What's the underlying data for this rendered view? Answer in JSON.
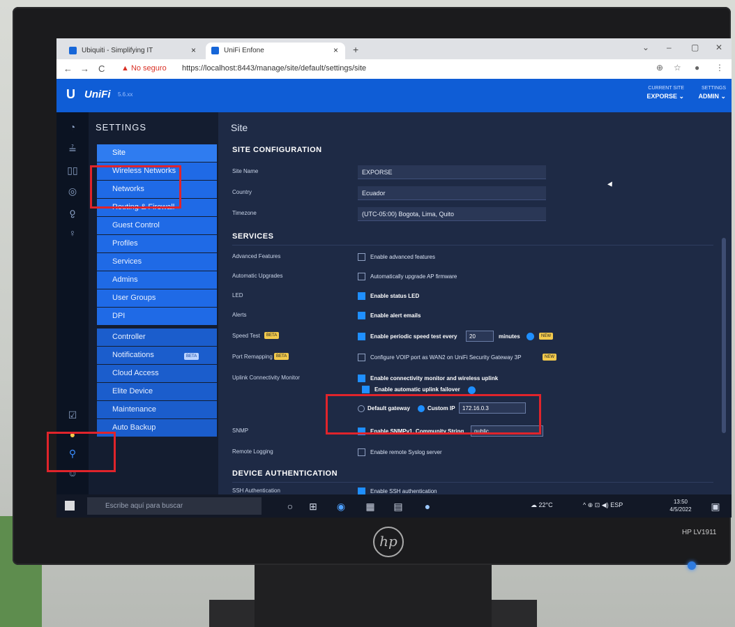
{
  "browser": {
    "tabs": [
      {
        "label": "Ubiquiti - Simplifying IT",
        "close": "×"
      },
      {
        "label": "UniFi Enfone",
        "close": "×"
      }
    ],
    "new_tab": "+",
    "window_controls": [
      "⌄",
      "–",
      "▢",
      "✕"
    ],
    "nav": {
      "back": "←",
      "forward": "→",
      "reload": "C"
    },
    "insecure_label": "▲ No seguro",
    "url": "https://localhost:8443/manage/site/default/settings/site",
    "addr_icons": [
      "⊕",
      "☆",
      "●",
      "⋮"
    ]
  },
  "unifi": {
    "logo": "U",
    "brand": "UniFi",
    "version": "5.6.xx",
    "site_label": "CURRENT SITE",
    "site_value": "EXPORSE ⌄",
    "admin_label": "SETTINGS",
    "admin_value": "ADMIN ⌄"
  },
  "rail_icons": [
    "◔",
    "≟",
    "▯▯",
    "◎",
    "ჹ",
    "♀",
    "☑",
    "●",
    "⚲",
    "☺"
  ],
  "settings": {
    "title": "SETTINGS",
    "items": [
      {
        "label": "Site"
      },
      {
        "label": "Wireless Networks"
      },
      {
        "label": "Networks"
      },
      {
        "label": "Routing & Firewall"
      },
      {
        "label": "Guest Control"
      },
      {
        "label": "Profiles"
      },
      {
        "label": "Services"
      },
      {
        "label": "Admins"
      },
      {
        "label": "User Groups"
      },
      {
        "label": "DPI"
      },
      {
        "label": "Controller"
      },
      {
        "label": "Notifications",
        "badge": "BETA"
      },
      {
        "label": "Cloud Access"
      },
      {
        "label": "Elite Device"
      },
      {
        "label": "Maintenance"
      },
      {
        "label": "Auto Backup"
      }
    ]
  },
  "content": {
    "page_title": "Site",
    "site_configuration": "SITE CONFIGURATION",
    "site_name_label": "Site Name",
    "site_name_value": "EXPORSE",
    "country_label": "Country",
    "country_value": "Ecuador",
    "timezone_label": "Timezone",
    "timezone_value": "(UTC-05:00) Bogota, Lima, Quito",
    "services": "SERVICES",
    "advanced_label": "Advanced Features",
    "advanced_check": "Enable advanced features",
    "upgrades_label": "Automatic Upgrades",
    "upgrades_check": "Automatically upgrade AP firmware",
    "led_label": "LED",
    "led_check": "Enable status LED",
    "alerts_label": "Alerts",
    "alerts_check": "Enable alert emails",
    "speedtest_label": "Speed Test",
    "speedtest_badge": "BETA",
    "speedtest_check": "Enable periodic speed test every",
    "speedtest_value": "20",
    "speedtest_unit": "minutes",
    "speedtest_new": "NEW",
    "portremap_label": "Port Remapping",
    "portremap_badge": "BETA",
    "portremap_check": "Configure VOIP port as WAN2 on UniFi Security Gateway 3P",
    "portremap_new": "NEW",
    "uplink_label": "Uplink Connectivity Monitor",
    "uplink_check": "Enable connectivity monitor and wireless uplink",
    "uplink_sub": "Enable automatic uplink failover",
    "default_gw": "Default gateway",
    "custom_ip": "Custom IP",
    "custom_ip_value": "172.16.0.3",
    "snmp_label": "SNMP",
    "snmp_check": "Enable SNMPv1, Community String",
    "snmp_value": "public",
    "remote_label": "Remote Logging",
    "remote_check": "Enable remote Syslog server",
    "device_auth": "DEVICE AUTHENTICATION",
    "ssh_label": "SSH Authentication",
    "ssh_check": "Enable SSH authentication"
  },
  "taskbar": {
    "search_placeholder": "Escribe aquí para buscar",
    "icons": [
      "○",
      "⊞",
      "◉",
      "▦",
      "▤",
      "●"
    ],
    "weather": "☁ 22°C",
    "tray": "^ ⊕ ⊡ ◀) ESP",
    "time": "13:50",
    "date": "4/5/2022"
  },
  "monitor": {
    "brand": "hp",
    "model": "HP LV1911"
  },
  "colors": {
    "annotation_red": "#e0242b",
    "unifi_blue": "#0f5dd6",
    "menu_blue": "#1f6ae6"
  }
}
